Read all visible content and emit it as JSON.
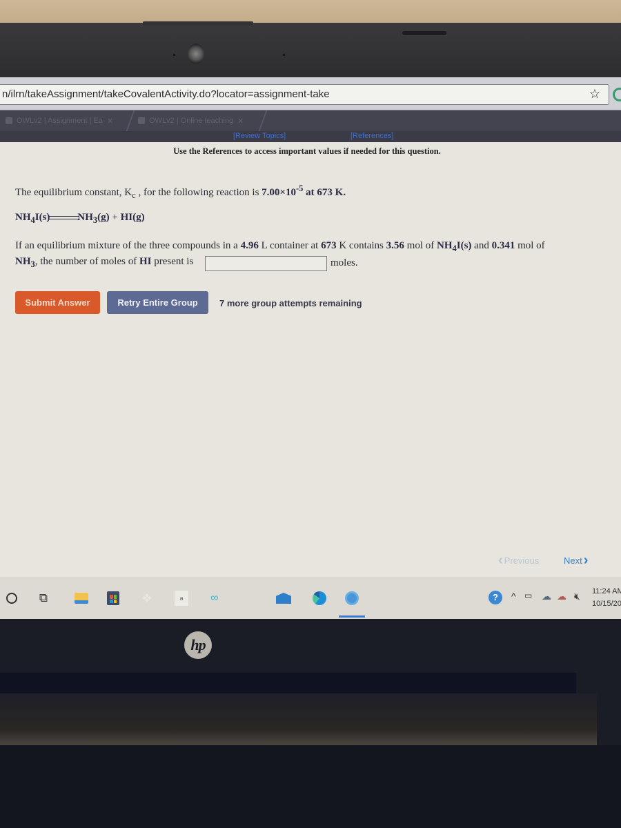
{
  "browser": {
    "url": "n/ilrn/takeAssignment/takeCovalentActivity.do?locator=assignment-take",
    "tabs": [
      {
        "label": "OWLv2 | Assignment | Ea"
      },
      {
        "label": "OWLv2 | Online teaching"
      }
    ]
  },
  "header_links": {
    "review_topics": "[Review Topics]",
    "references": "[References]"
  },
  "reference_note": "Use the References to access important values if needed for this question.",
  "question": {
    "intro_prefix": "The equilibrium constant, K",
    "intro_sub": "c",
    "intro_mid": " , for the following reaction is ",
    "kc_value": "7.00×10",
    "kc_exp": "-5",
    "temp_intro": " at 673 K.",
    "reaction": {
      "reactant": "NH",
      "reactant_sub": "4",
      "reactant_rest": "I(s)",
      "product1": "NH",
      "product1_sub": "3",
      "product1_rest": "(g)",
      "plus": " + ",
      "product2": "HI(g)"
    },
    "line2_a": "If an equilibrium mixture of the three compounds in a ",
    "volume": "4.96",
    "line2_b": " L container at ",
    "temp": "673",
    "line2_c": " K contains ",
    "mol_nh4i": "3.56",
    "line2_d": " mol of ",
    "nh4i": "NH",
    "nh4i_sub": "4",
    "nh4i_rest": "I(s)",
    "line2_e": " and ",
    "mol_nh3": "0.341",
    "line2_f": " mol of",
    "nh3": "NH",
    "nh3_sub": "3",
    "line3_a": ", the number of moles of ",
    "hi": "HI",
    "line3_b": " present is",
    "answer_value": "",
    "unit": "moles."
  },
  "actions": {
    "submit": "Submit Answer",
    "retry": "Retry Entire Group",
    "attempts": "7 more group attempts remaining"
  },
  "pager": {
    "previous": "Previous",
    "next": "Next"
  },
  "taskbar": {
    "time": "11:24 AM",
    "date": "10/15/20"
  },
  "brand": "hp"
}
